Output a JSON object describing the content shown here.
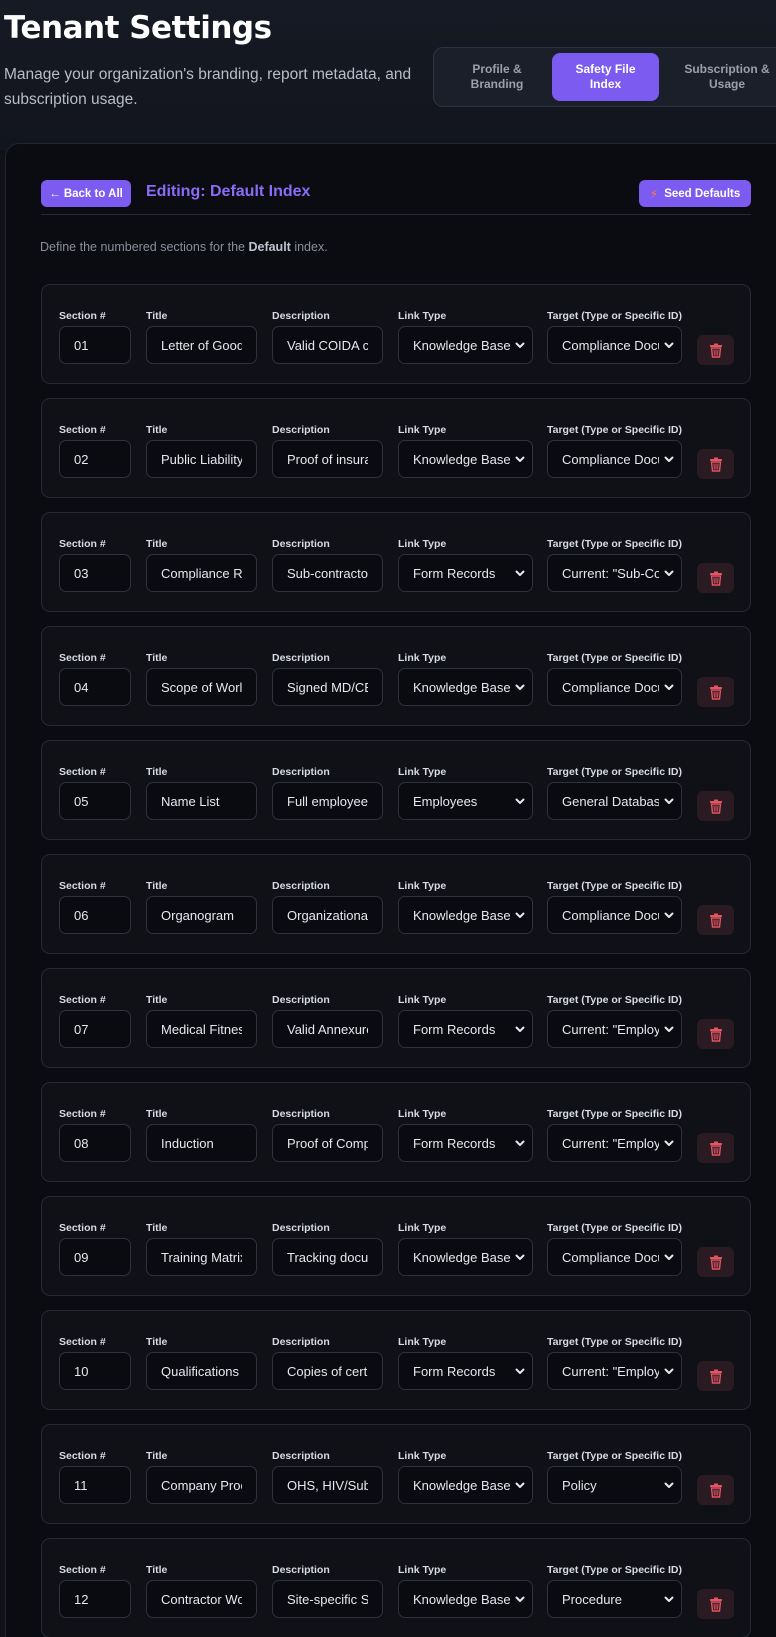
{
  "header": {
    "title": "Tenant Settings",
    "subtitle": "Manage your organization's branding, report metadata, and subscription usage."
  },
  "tabs": [
    {
      "label": "Profile &\nBranding",
      "active": false
    },
    {
      "label": "Safety File\nIndex",
      "active": true
    },
    {
      "label": "Subscription &\nUsage",
      "active": false
    }
  ],
  "toolbar": {
    "back_label": "← Back to All",
    "editing_title": "Editing: Default Index",
    "seed_label": "Seed Defaults",
    "seed_icon": "bolt-icon"
  },
  "description": {
    "prefix": "Define the numbered sections for the ",
    "index_name": "Default",
    "suffix": " index."
  },
  "labels": {
    "section": "Section #",
    "title": "Title",
    "description": "Description",
    "link_type": "Link Type",
    "target": "Target (Type or Specific ID)"
  },
  "colors": {
    "accent": "#7c5cf0",
    "accent_text": "#8b6cf6",
    "delete": "#e25563",
    "background": "#0b0c11"
  },
  "sections": [
    {
      "num": "01",
      "title": "Letter of Good",
      "description": "Valid COIDA c",
      "link_type": "Knowledge Base",
      "target": "Compliance Docu"
    },
    {
      "num": "02",
      "title": "Public Liability",
      "description": "Proof of insura",
      "link_type": "Knowledge Base",
      "target": "Compliance Docu"
    },
    {
      "num": "03",
      "title": "Compliance Re",
      "description": "Sub-contracto",
      "link_type": "Form Records",
      "target": "Current: \"Sub-Con"
    },
    {
      "num": "04",
      "title": "Scope of Worl",
      "description": "Signed MD/CE",
      "link_type": "Knowledge Base",
      "target": "Compliance Docu"
    },
    {
      "num": "05",
      "title": "Name List",
      "description": "Full employee",
      "link_type": "Employees",
      "target": "General Database"
    },
    {
      "num": "06",
      "title": "Organogram",
      "description": "Organizational",
      "link_type": "Knowledge Base",
      "target": "Compliance Docu"
    },
    {
      "num": "07",
      "title": "Medical Fitnes",
      "description": "Valid Annexure",
      "link_type": "Form Records",
      "target": "Current: \"Employe"
    },
    {
      "num": "08",
      "title": "Induction",
      "description": "Proof of Comp",
      "link_type": "Form Records",
      "target": "Current: \"Employe"
    },
    {
      "num": "09",
      "title": "Training Matrix",
      "description": "Tracking docu",
      "link_type": "Knowledge Base",
      "target": "Compliance Docu"
    },
    {
      "num": "10",
      "title": "Qualifications",
      "description": "Copies of cert",
      "link_type": "Form Records",
      "target": "Current: \"Employe"
    },
    {
      "num": "11",
      "title": "Company Proc",
      "description": "OHS, HIV/Subs",
      "link_type": "Knowledge Base",
      "target": "Policy"
    },
    {
      "num": "12",
      "title": "Contractor Wo",
      "description": "Site-specific S",
      "link_type": "Knowledge Base",
      "target": "Procedure"
    }
  ]
}
